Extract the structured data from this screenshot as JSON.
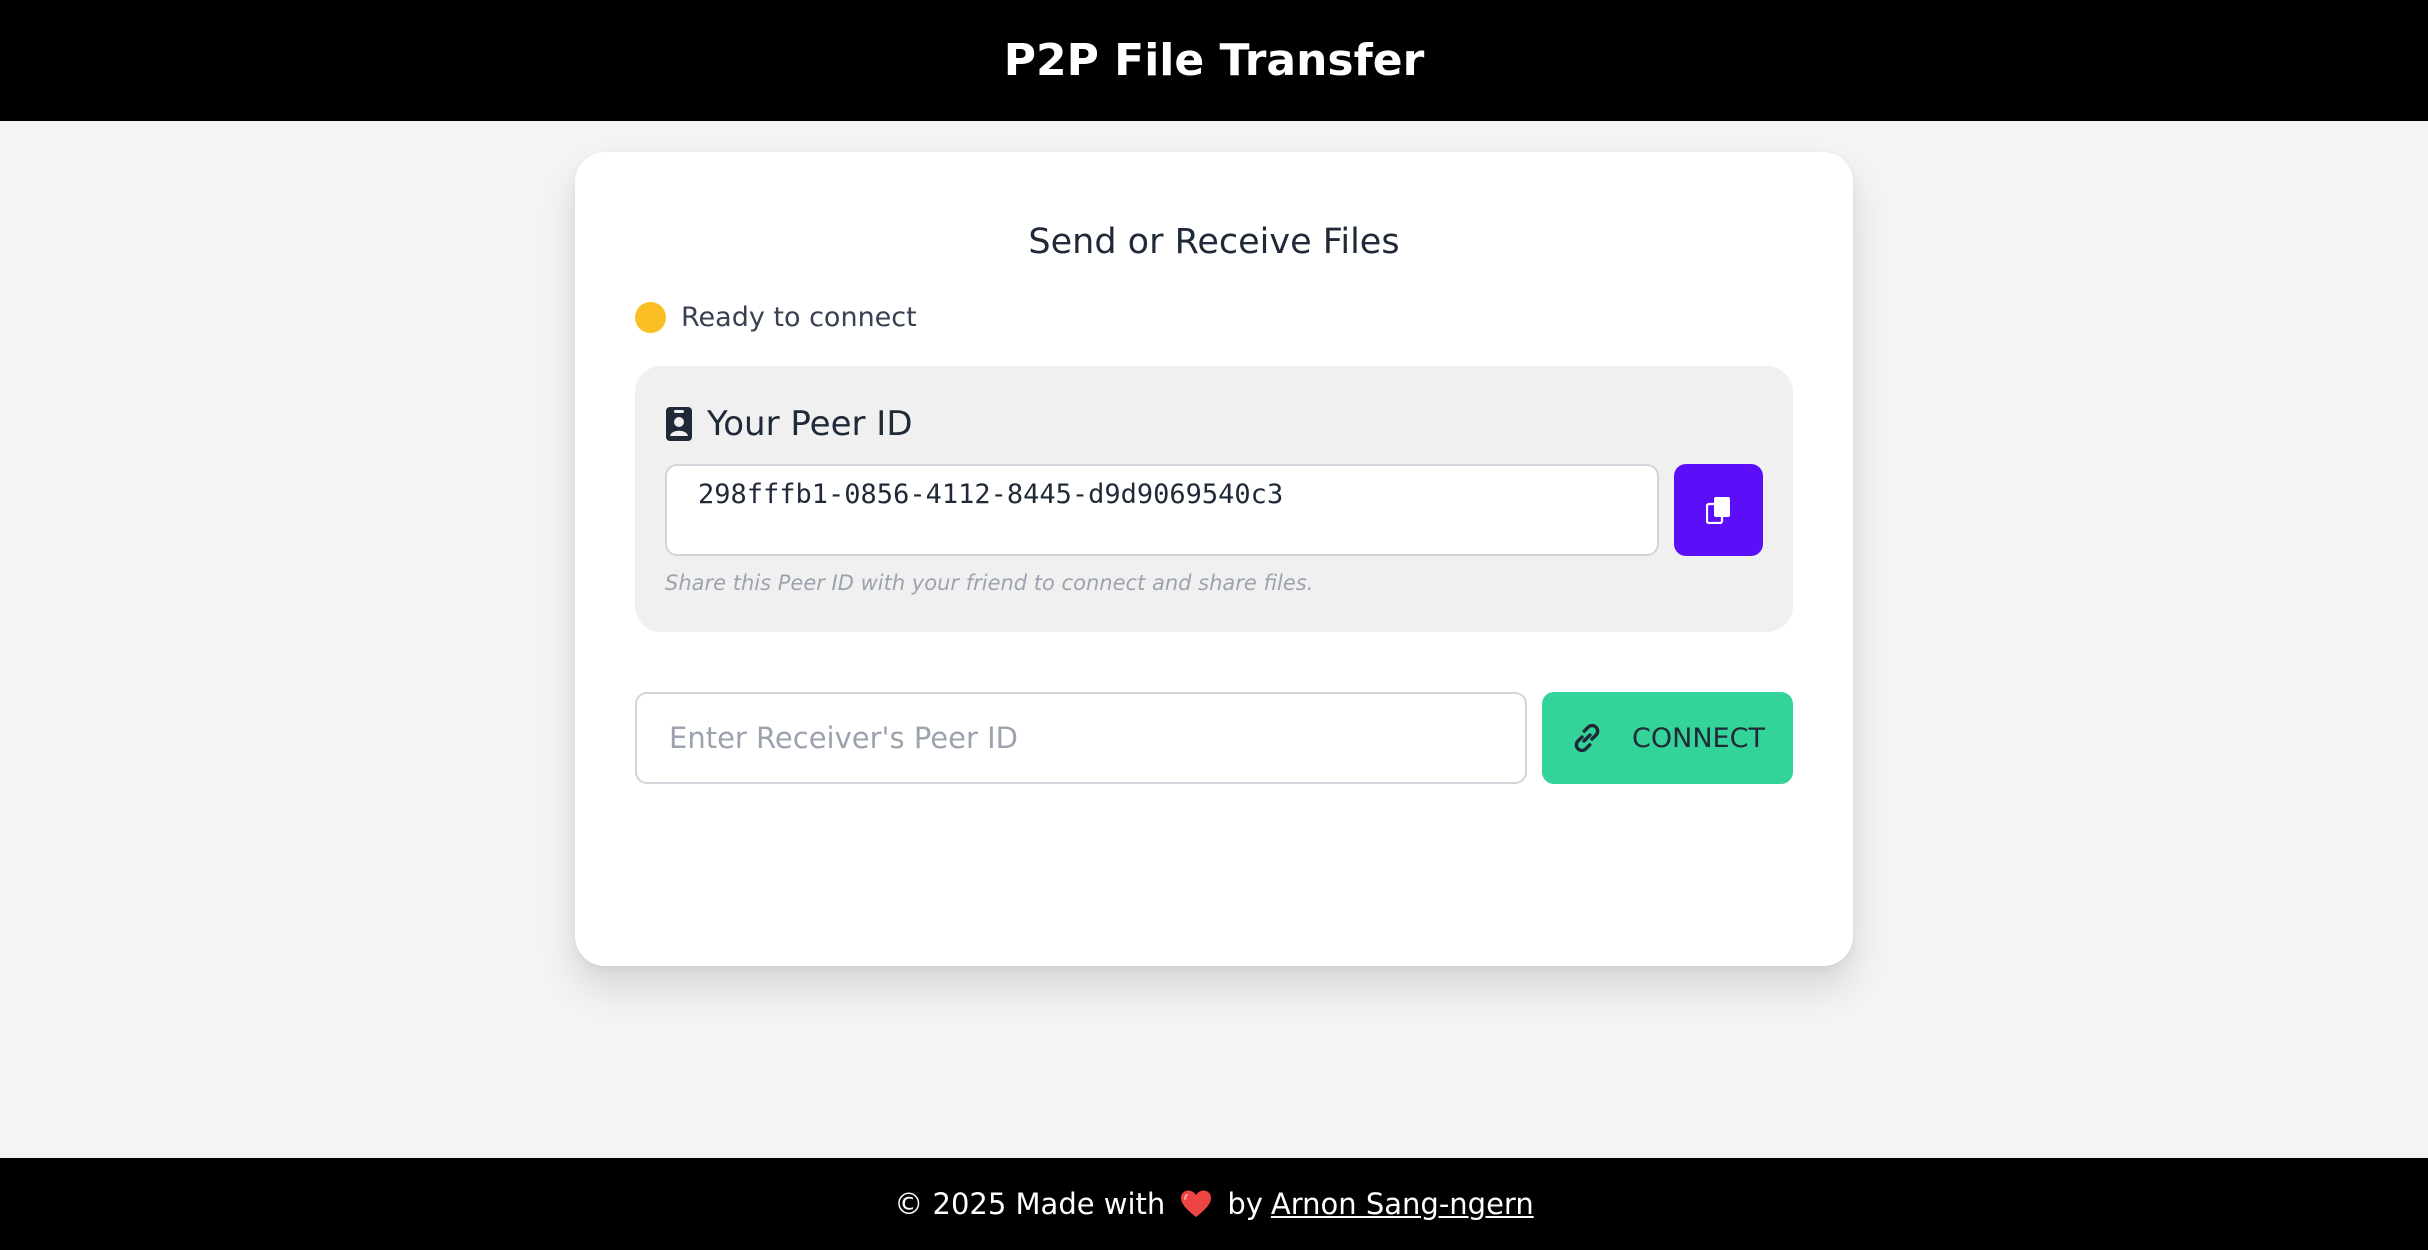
{
  "header": {
    "title": "P2P File Transfer"
  },
  "card": {
    "title": "Send or Receive Files",
    "status": {
      "text": "Ready to connect",
      "color": "#fbbf24"
    },
    "peer": {
      "label": "Your Peer ID",
      "id": "298fffb1-0856-4112-8445-d9d9069540c3",
      "hint": "Share this Peer ID with your friend to connect and share files.",
      "copy_icon": "copy-icon",
      "label_icon": "id-badge-icon"
    },
    "connect": {
      "placeholder": "Enter Receiver's Peer ID",
      "value": "",
      "button_label": "CONNECT",
      "button_icon": "link-icon"
    }
  },
  "footer": {
    "prefix": "© 2025 Made with",
    "by": "by",
    "author": "Arnon Sang-ngern"
  },
  "colors": {
    "header_bg": "#000000",
    "copy_button": "#5b0ef7",
    "connect_button": "#34d399",
    "status_dot": "#fbbf24",
    "heart": "#ef4444"
  }
}
